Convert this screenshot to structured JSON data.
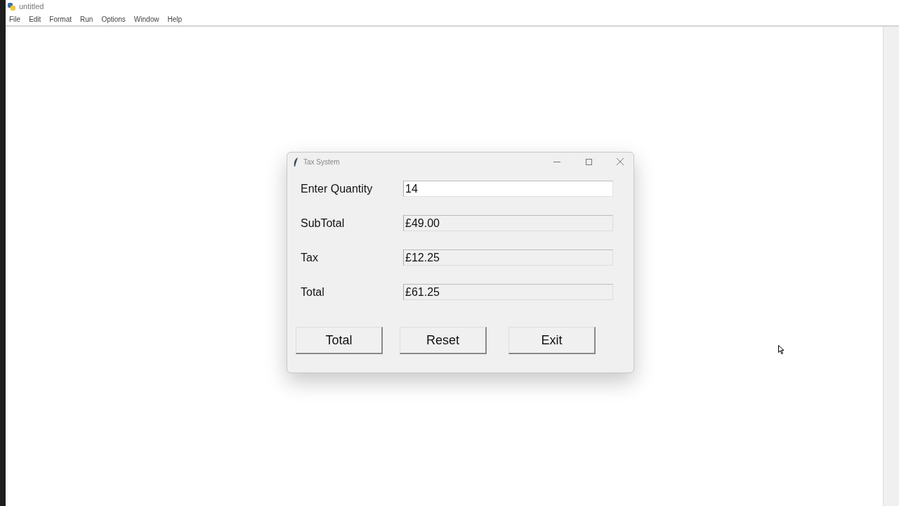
{
  "window": {
    "title": "untitled"
  },
  "menu": [
    "File",
    "Edit",
    "Format",
    "Run",
    "Options",
    "Window",
    "Help"
  ],
  "dialog": {
    "title": "Tax System",
    "fields": [
      {
        "label": "Enter Quantity",
        "value": "14",
        "readonly": false
      },
      {
        "label": "SubTotal",
        "value": "£49.00",
        "readonly": true
      },
      {
        "label": "Tax",
        "value": "£12.25",
        "readonly": true
      },
      {
        "label": "Total",
        "value": "£61.25",
        "readonly": true
      }
    ],
    "buttons": [
      "Total",
      "Reset",
      "Exit"
    ]
  }
}
